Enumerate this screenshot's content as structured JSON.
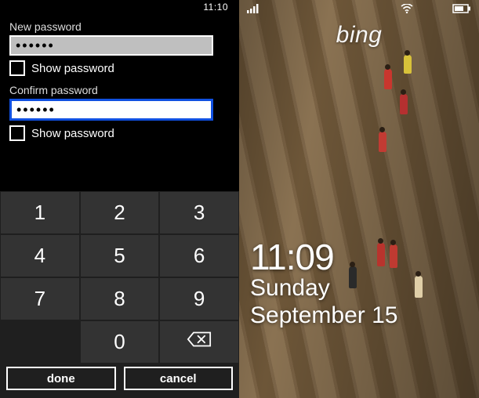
{
  "left": {
    "status_time": "11:10",
    "new_password_label": "New password",
    "new_password_value": "••••••",
    "show_password_label_1": "Show password",
    "confirm_password_label": "Confirm password",
    "confirm_password_value": "••••••",
    "show_password_label_2": "Show password",
    "keypad": {
      "k1": "1",
      "k2": "2",
      "k3": "3",
      "k4": "4",
      "k5": "5",
      "k6": "6",
      "k7": "7",
      "k8": "8",
      "k9": "9",
      "k0": "0"
    },
    "done_label": "done",
    "cancel_label": "cancel"
  },
  "right": {
    "brand": "bing",
    "lock_time": "11:09",
    "lock_day": "Sunday",
    "lock_date": "September 15"
  }
}
